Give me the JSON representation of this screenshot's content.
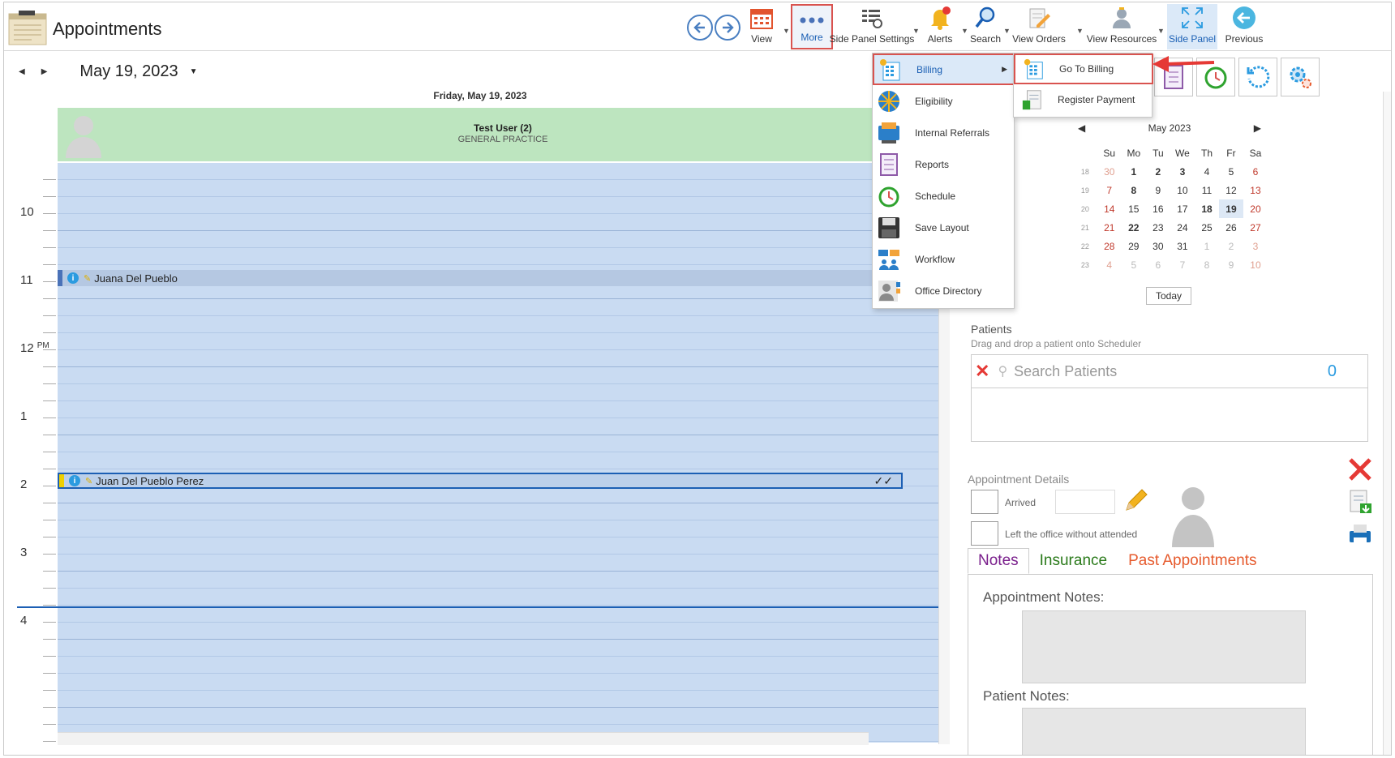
{
  "app": {
    "title": "Appointments"
  },
  "toolbar": {
    "view": "View",
    "more": "More",
    "side_panel_settings": "Side Panel Settings",
    "alerts": "Alerts",
    "search": "Search",
    "view_orders": "View Orders",
    "view_resources": "View Resources",
    "side_panel": "Side Panel",
    "previous": "Previous"
  },
  "date_nav": {
    "date": "May 19, 2023"
  },
  "scheduler": {
    "day_header": "Friday, May 19, 2023",
    "resource": {
      "name": "Test User (2)",
      "specialty": "GENERAL PRACTICE"
    },
    "hours": [
      {
        "label": "10",
        "suffix": ""
      },
      {
        "label": "11",
        "suffix": ""
      },
      {
        "label": "12",
        "suffix": "PM"
      },
      {
        "label": "1",
        "suffix": ""
      },
      {
        "label": "2",
        "suffix": ""
      },
      {
        "label": "3",
        "suffix": ""
      },
      {
        "label": "4",
        "suffix": ""
      }
    ],
    "appointments": [
      {
        "patient": "Juana Del Pueblo",
        "selected": false
      },
      {
        "patient": "Juan Del Pueblo Perez",
        "selected": true,
        "status": "✓✓"
      }
    ]
  },
  "more_menu": {
    "items": [
      {
        "label": "Billing",
        "icon": "billing-icon",
        "has_submenu": true,
        "highlighted": true
      },
      {
        "label": "Eligibility",
        "icon": "eligibility-icon"
      },
      {
        "label": "Internal Referrals",
        "icon": "referrals-icon"
      },
      {
        "label": "Reports",
        "icon": "reports-icon"
      },
      {
        "label": "Schedule",
        "icon": "schedule-icon"
      },
      {
        "label": "Save Layout",
        "icon": "save-icon"
      },
      {
        "label": "Workflow",
        "icon": "workflow-icon"
      },
      {
        "label": "Office Directory",
        "icon": "directory-icon"
      }
    ]
  },
  "billing_submenu": {
    "items": [
      {
        "label": "Go To Billing",
        "icon": "go-billing-icon",
        "highlighted": true
      },
      {
        "label": "Register Payment",
        "icon": "register-payment-icon"
      }
    ]
  },
  "mini_calendar": {
    "title": "May 2023",
    "weekdays": [
      "Su",
      "Mo",
      "Tu",
      "We",
      "Th",
      "Fr",
      "Sa"
    ],
    "weeks": [
      {
        "wk": "18",
        "days": [
          "30",
          "1",
          "2",
          "3",
          "4",
          "5",
          "6"
        ]
      },
      {
        "wk": "19",
        "days": [
          "7",
          "8",
          "9",
          "10",
          "11",
          "12",
          "13"
        ]
      },
      {
        "wk": "20",
        "days": [
          "14",
          "15",
          "16",
          "17",
          "18",
          "19",
          "20"
        ]
      },
      {
        "wk": "21",
        "days": [
          "21",
          "22",
          "23",
          "24",
          "25",
          "26",
          "27"
        ]
      },
      {
        "wk": "22",
        "days": [
          "28",
          "29",
          "30",
          "31",
          "1",
          "2",
          "3"
        ]
      },
      {
        "wk": "23",
        "days": [
          "4",
          "5",
          "6",
          "7",
          "8",
          "9",
          "10"
        ]
      }
    ],
    "today_label": "Today"
  },
  "patients": {
    "title": "Patients",
    "hint": "Drag and drop a patient onto Scheduler",
    "search_placeholder": "Search Patients",
    "count": "0"
  },
  "appointment_details": {
    "title": "Appointment Details",
    "arrived": "Arrived",
    "left_without": "Left the office without attended"
  },
  "tabs": {
    "notes": "Notes",
    "insurance": "Insurance",
    "past": "Past Appointments"
  },
  "notes": {
    "appointment_notes": "Appointment Notes:",
    "patient_notes": "Patient Notes:"
  },
  "colors": {
    "accent": "#1a5fb4",
    "highlight_border": "#d9534f",
    "schedule_bg": "#c9dbf2",
    "resource_bg": "#bde5bf"
  }
}
